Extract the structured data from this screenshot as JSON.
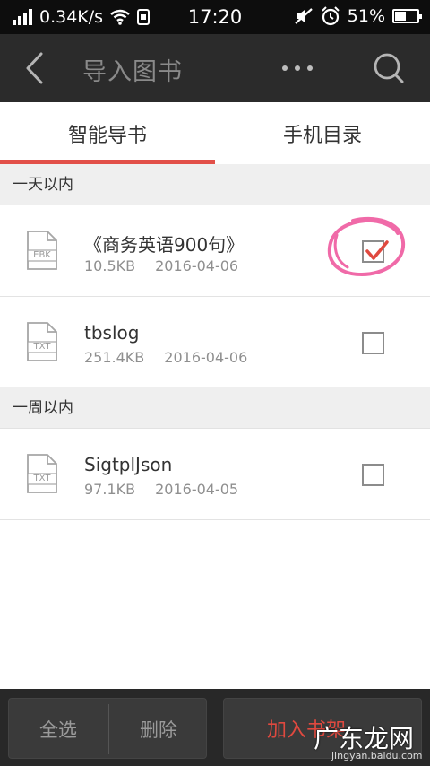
{
  "status_bar": {
    "speed": "0.34K/s",
    "time": "17:20",
    "battery_percent": "51%",
    "battery_level": 0.51
  },
  "title_bar": {
    "title": "导入图书",
    "more_label": "•••"
  },
  "tabs": [
    {
      "label": "智能导书",
      "active": true
    },
    {
      "label": "手机目录",
      "active": false
    }
  ],
  "sections": [
    {
      "header": "一天以内",
      "files": [
        {
          "type": "EBK",
          "name": "《商务英语900句》",
          "size": "10.5KB",
          "date": "2016-04-06",
          "checked": true
        },
        {
          "type": "TXT",
          "name": "tbslog",
          "size": "251.4KB",
          "date": "2016-04-06",
          "checked": false
        }
      ]
    },
    {
      "header": "一周以内",
      "files": [
        {
          "type": "TXT",
          "name": "SigtplJson",
          "size": "97.1KB",
          "date": "2016-04-05",
          "checked": false
        }
      ]
    }
  ],
  "bottom_bar": {
    "select_all": "全选",
    "delete": "删除",
    "add_to_shelf": "加入书架"
  },
  "watermark": {
    "text": "广东龙网",
    "url": "jingyan.baidu.com"
  },
  "colors": {
    "accent": "#e25049",
    "title_bar": "#2b2b2b",
    "annotation": "#f06aa8"
  }
}
